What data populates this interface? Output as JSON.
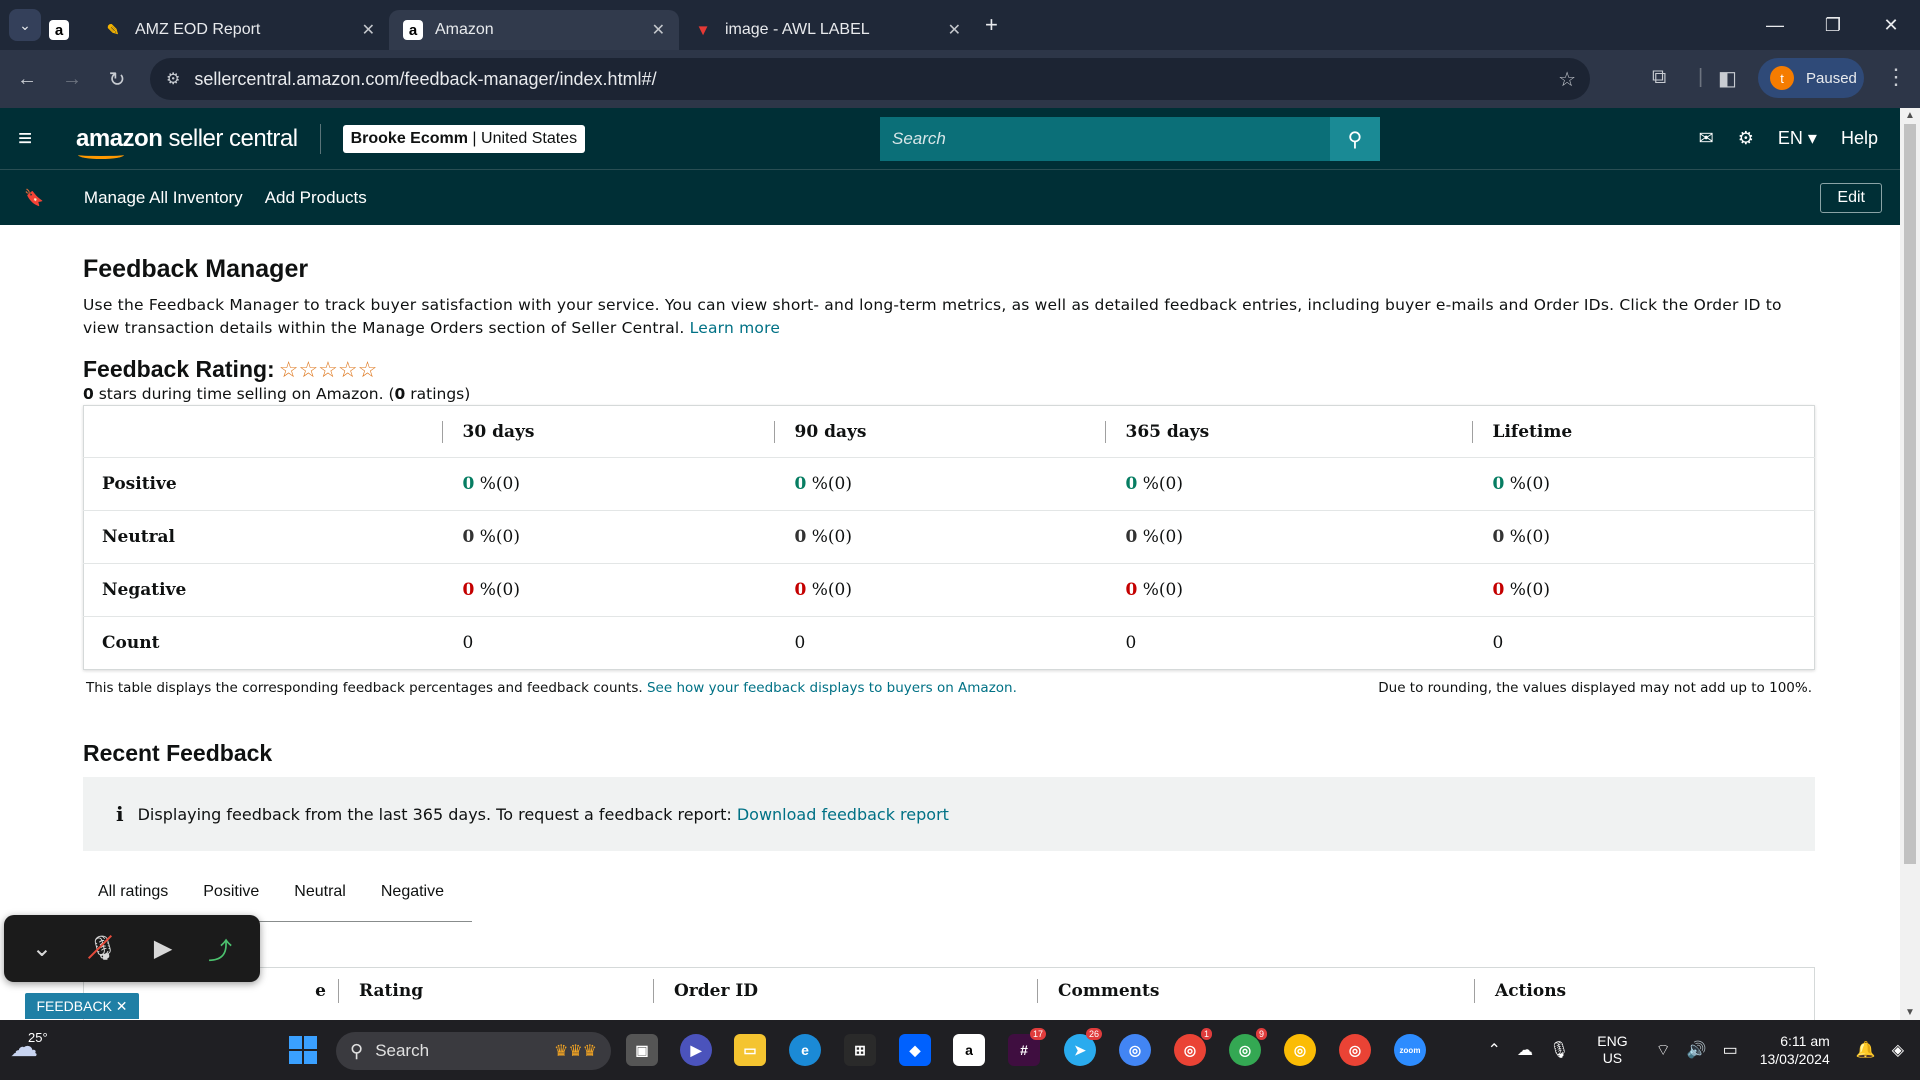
{
  "browser": {
    "tabs": [
      {
        "label": "",
        "favicon": "a"
      },
      {
        "label": "AMZ EOD Report",
        "favicon": "pencil-icon"
      },
      {
        "label": "Amazon",
        "favicon": "a"
      },
      {
        "label": "image - AWL LABEL",
        "favicon": "image-icon"
      }
    ],
    "url": "sellercentral.amazon.com/feedback-manager/index.html#/",
    "profile_initial": "t",
    "profile_status": "Paused"
  },
  "header": {
    "logo_bold": "amazon",
    "logo_rest": " seller central",
    "account_name": "Brooke Ecomm",
    "account_region": "United States",
    "search_placeholder": "Search",
    "lang": "EN",
    "help": "Help"
  },
  "subnav": {
    "links": [
      "Manage All Inventory",
      "Add Products"
    ],
    "edit": "Edit"
  },
  "page": {
    "title": "Feedback Manager",
    "intro": "Use the Feedback Manager to track buyer satisfaction with your service. You can view short- and long-term metrics, as well as detailed feedback entries, including buyer e-mails and Order IDs. Click the Order ID to view transaction details within the Manage Orders section of Seller Central.",
    "learn_more": "Learn more",
    "rating_label": "Feedback Rating:",
    "stars": "☆☆☆☆☆",
    "stars_count": "0",
    "stars_text": " stars during time selling on Amazon. (",
    "ratings_count": "0",
    "ratings_text": " ratings)"
  },
  "feedback_table": {
    "columns": [
      "30 days",
      "90 days",
      "365 days",
      "Lifetime"
    ],
    "rows": [
      {
        "label": "Positive",
        "cells": [
          {
            "v": "0",
            "p": " %(0)"
          },
          {
            "v": "0",
            "p": " %(0)"
          },
          {
            "v": "0",
            "p": " %(0)"
          },
          {
            "v": "0",
            "p": " %(0)"
          }
        ]
      },
      {
        "label": "Neutral",
        "cells": [
          {
            "v": "0",
            "p": " %(0)"
          },
          {
            "v": "0",
            "p": " %(0)"
          },
          {
            "v": "0",
            "p": " %(0)"
          },
          {
            "v": "0",
            "p": " %(0)"
          }
        ]
      },
      {
        "label": "Negative",
        "cells": [
          {
            "v": "0",
            "p": " %(0)"
          },
          {
            "v": "0",
            "p": " %(0)"
          },
          {
            "v": "0",
            "p": " %(0)"
          },
          {
            "v": "0",
            "p": " %(0)"
          }
        ]
      },
      {
        "label": "Count",
        "cells": [
          {
            "v": "0",
            "p": ""
          },
          {
            "v": "0",
            "p": ""
          },
          {
            "v": "0",
            "p": ""
          },
          {
            "v": "0",
            "p": ""
          }
        ]
      }
    ],
    "footnote": "This table displays the corresponding feedback percentages and feedback counts.",
    "footnote_link": "See how your feedback displays to buyers on Amazon.",
    "rounding_note": "Due to rounding, the values displayed may not add up to 100%."
  },
  "recent": {
    "title": "Recent Feedback",
    "info_icon": "i",
    "info_text": "Displaying feedback from the last 365 days. To request a feedback report:",
    "info_link": "Download feedback report",
    "tabs": [
      "All ratings",
      "Positive",
      "Neutral",
      "Negative"
    ],
    "columns": [
      "e",
      "Rating",
      "Order ID",
      "Comments",
      "Actions"
    ]
  },
  "overlay": {
    "feedback_tag": "FEEDBACK ✕"
  },
  "taskbar": {
    "temperature": "25°",
    "search": "Search",
    "lang_top": "ENG",
    "lang_bottom": "US",
    "time": "6:11 am",
    "date": "13/03/2024",
    "badges": {
      "slack": "17",
      "telegram": "26",
      "chrome1": "1",
      "chrome2": "9"
    }
  },
  "colors": {
    "brand_dark": "#002f36",
    "positive": "#067d62",
    "negative": "#c40000",
    "link": "#007185",
    "star": "#de7921"
  }
}
